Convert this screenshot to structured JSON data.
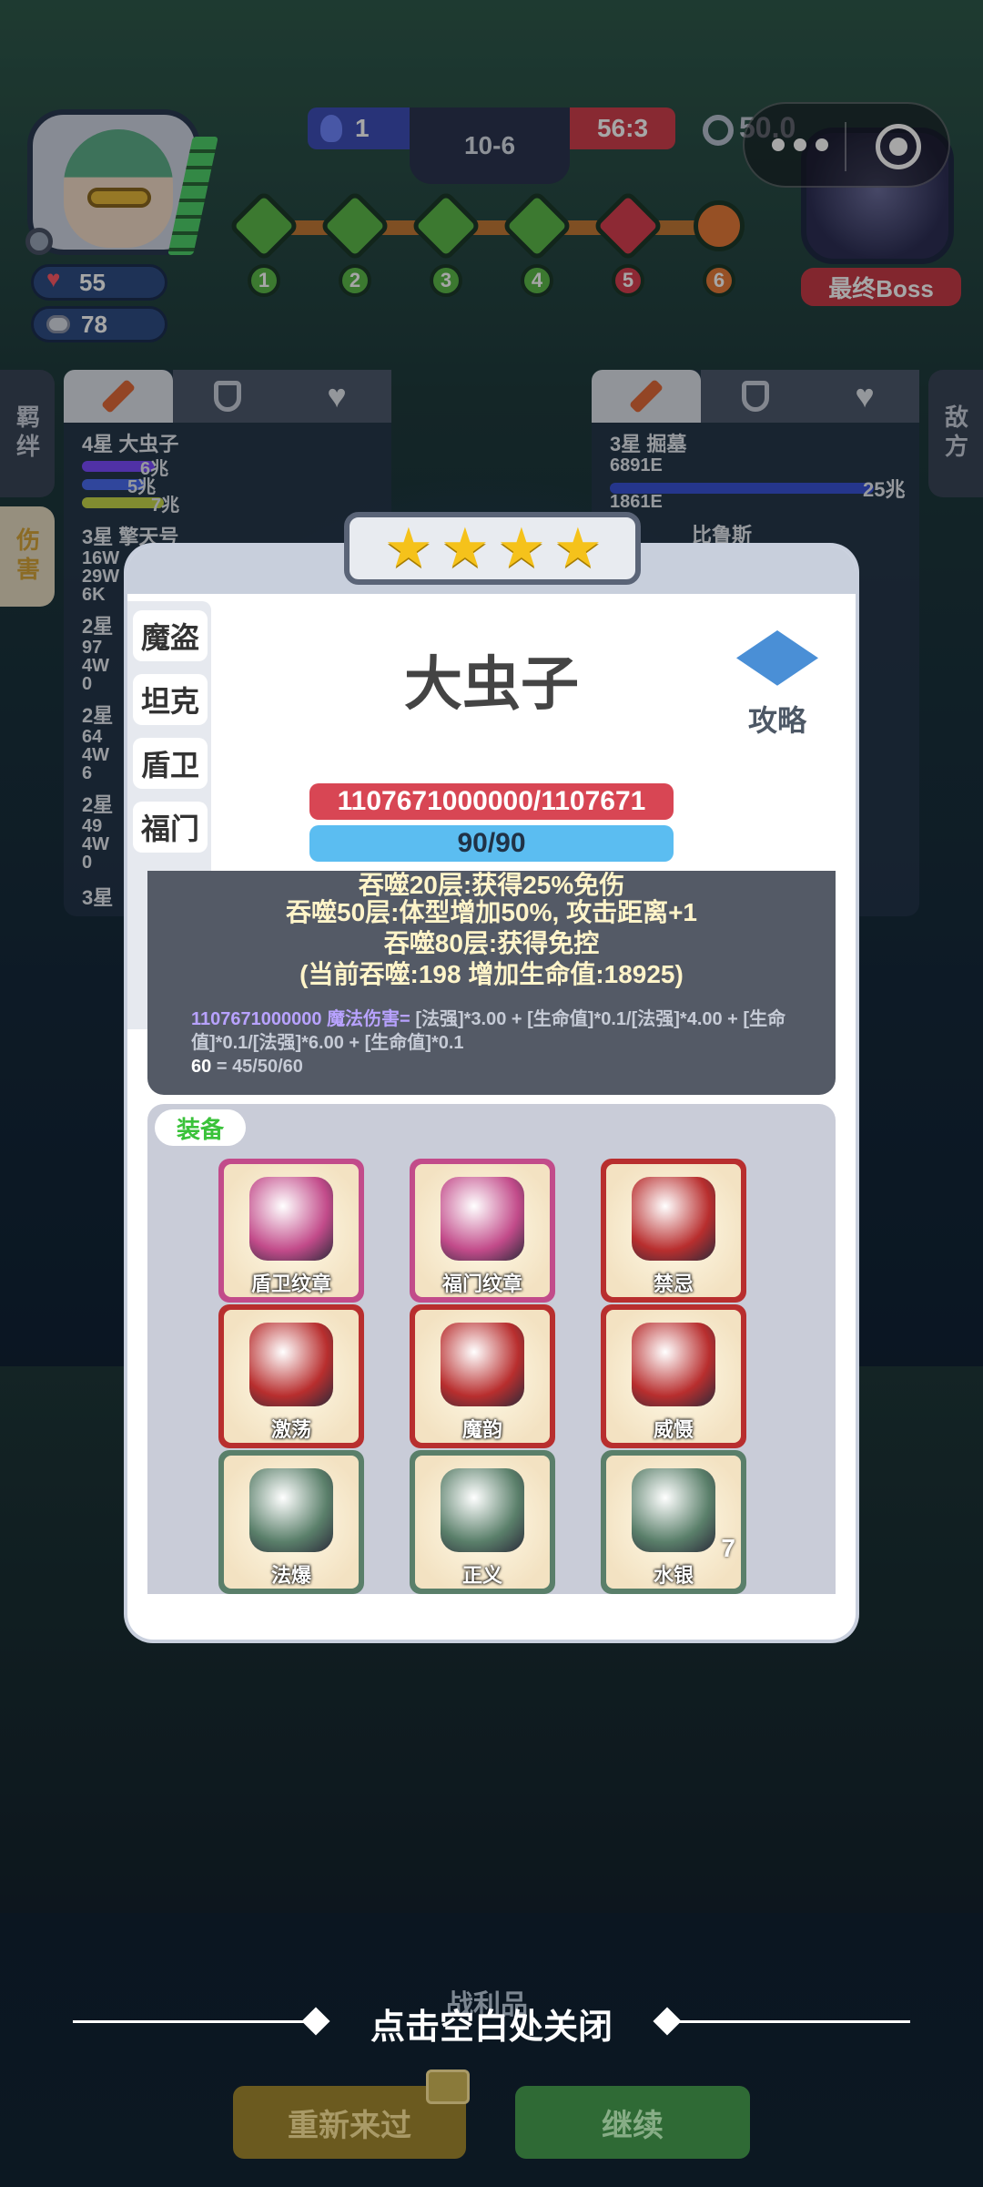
{
  "hud": {
    "hp": "55",
    "coins": "78",
    "team_score": "1",
    "round": "10-6",
    "timer": "56:3",
    "speed": "50.0",
    "boss_label": "最终Boss",
    "stages": [
      "1",
      "2",
      "3",
      "4",
      "5",
      "6"
    ]
  },
  "left_panel": {
    "side_tab": "羁绊",
    "damage_tab": "伤害",
    "rows": [
      {
        "name": "4星 大虫子",
        "v1": "6兆",
        "v2": "5兆",
        "v3": "7兆"
      },
      {
        "name": "3星 擎天号",
        "v1": "16W",
        "v2": "29W",
        "v3": "6K"
      },
      {
        "name": "2星",
        "v1": "97",
        "v2": "4W",
        "v3": "0"
      },
      {
        "name": "2星",
        "v1": "64",
        "v2": "4W",
        "v3": "6"
      },
      {
        "name": "2星",
        "v1": "49",
        "v2": "4W",
        "v3": "0"
      },
      {
        "name": "3星",
        "v1": "",
        "v2": "",
        "v3": ""
      }
    ]
  },
  "right_panel": {
    "side_tab": "敌方",
    "rows": [
      {
        "name": "3星 掘墓",
        "v1": "6891E",
        "v2": "25兆"
      },
      {
        "name": "比鲁斯",
        "v1": "1861E",
        "v2": ""
      }
    ]
  },
  "modal": {
    "categories": [
      "魔盗",
      "坦克",
      "盾卫",
      "福门"
    ],
    "name": "大虫子",
    "strategy_label": "攻略",
    "hp_text": "1107671000000/1107671",
    "mp_text": "90/90",
    "desc_lines": [
      "吞噬20层:获得25%免伤",
      "吞噬50层:体型增加50%, 攻击距离+1",
      "吞噬80层:获得免控",
      "(当前吞噬:198 增加生命值:18925)"
    ],
    "formula": {
      "value": "1107671000000",
      "label": "魔法伤害=",
      "body": "[法强]*3.00 + [生命值]*0.1/[法强]*4.00 + [生命值]*0.1/[法强]*6.00 + [生命值]*0.1",
      "mana_total": "60",
      "mana_breakdown": "45/50/60"
    },
    "equip_tag": "装备",
    "items": [
      {
        "label": "盾卫纹章",
        "icon": "shield-crest-icon",
        "color": "#c24b8a",
        "count": ""
      },
      {
        "label": "福门纹章",
        "icon": "gold-crest-icon",
        "color": "#c24b8a",
        "count": ""
      },
      {
        "label": "禁忌",
        "icon": "forbidden-orb-icon",
        "color": "#b82e2e",
        "count": ""
      },
      {
        "label": "激荡",
        "icon": "purple-heart-icon",
        "color": "#b82e2e",
        "count": ""
      },
      {
        "label": "魔韵",
        "icon": "ice-staff-icon",
        "color": "#b82e2e",
        "count": ""
      },
      {
        "label": "威慑",
        "icon": "ice-armor-icon",
        "color": "#b82e2e",
        "count": ""
      },
      {
        "label": "法爆",
        "icon": "dragon-head-icon",
        "color": "#5a7f6a",
        "count": ""
      },
      {
        "label": "正义",
        "icon": "gold-gauntlet-icon",
        "color": "#5a7f6a",
        "count": ""
      },
      {
        "label": "水银",
        "icon": "hooded-cloak-icon",
        "color": "#5a7f6a",
        "count": "7"
      }
    ]
  },
  "footer": {
    "close_hint": "点击空白处关闭",
    "loot_label": "战利品",
    "retry_label": "重新来过",
    "continue_label": "继续"
  },
  "colors": {
    "hp_bar": "#d84654",
    "mp_bar": "#5bbdf1",
    "star": "#f5c21b",
    "equip_tag": "#3ac23a"
  }
}
